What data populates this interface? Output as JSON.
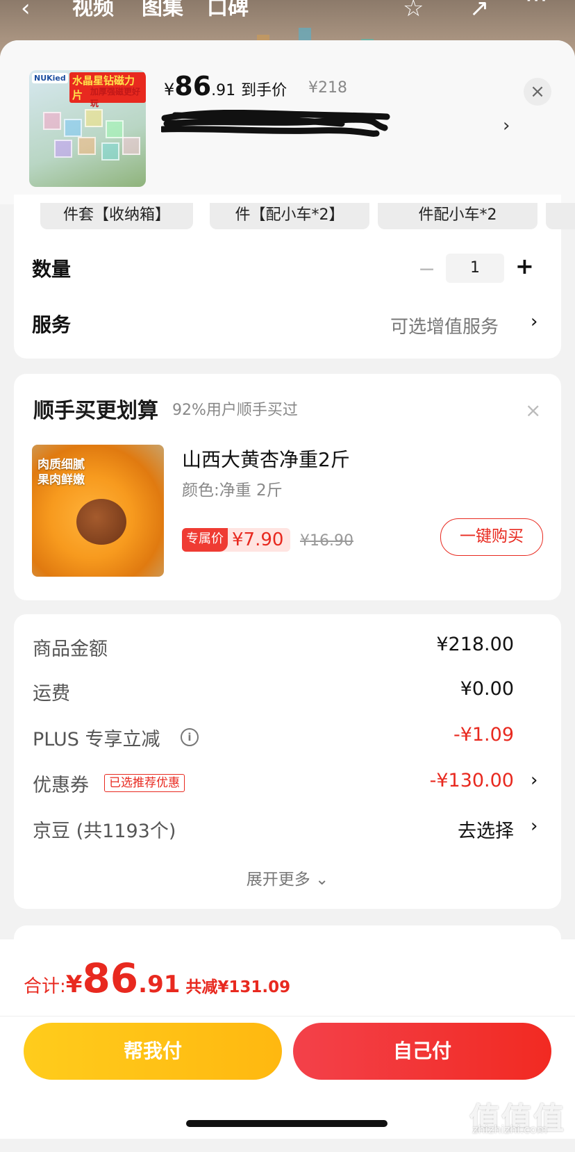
{
  "top_nav": {
    "tabs": [
      "视频",
      "图集",
      "口碑"
    ]
  },
  "product": {
    "thumb_brand": "NUKied",
    "thumb_title": "水晶星钻磁力片",
    "thumb_sub": "加厚强磁更好玩",
    "price_yen": "¥",
    "price_int": "86",
    "price_dec": ".91",
    "price_label": "到手价",
    "original_price": "¥218"
  },
  "variants": [
    "件套【收纳箱】",
    "件【配小车*2】",
    "件配小车*2"
  ],
  "quantity": {
    "label": "数量",
    "value": "1",
    "minus": "−",
    "plus": "+"
  },
  "service": {
    "label": "服务",
    "value": "可选增值服务"
  },
  "addon": {
    "title": "顺手买更划算",
    "subtitle": "92%用户顺手买过",
    "image_caption_1": "肉质细腻",
    "image_caption_2": "果肉鲜嫩",
    "name": "山西大黄杏净重2斤",
    "spec": "颜色:净重 2斤",
    "exclusive_tag": "专属价",
    "price": "¥7.90",
    "original_price": "¥16.90",
    "buy_label": "一键购买"
  },
  "fees": [
    {
      "label": "商品金额",
      "value": "¥218.00"
    },
    {
      "label": "运费",
      "value": "¥0.00"
    },
    {
      "label": "PLUS 专享立减",
      "value": "-¥1.09"
    },
    {
      "label": "优惠券",
      "value": "-¥130.00",
      "tag": "已选推荐优惠"
    },
    {
      "label": "京豆 (共1193个)",
      "value": "去选择"
    }
  ],
  "expand_more": "展开更多 ⌄",
  "total": {
    "label": "合计:",
    "yen": "¥",
    "int": "86",
    "dec": ".91",
    "save": "共减¥131.09"
  },
  "actions": {
    "help_pay": "帮我付",
    "self_pay": "自己付"
  },
  "watermark": {
    "main": "值值值",
    "url": "zhizhizhi.com"
  },
  "colors": {
    "accent_red": "#e8291f",
    "help_yellow": "#ffc01a"
  }
}
